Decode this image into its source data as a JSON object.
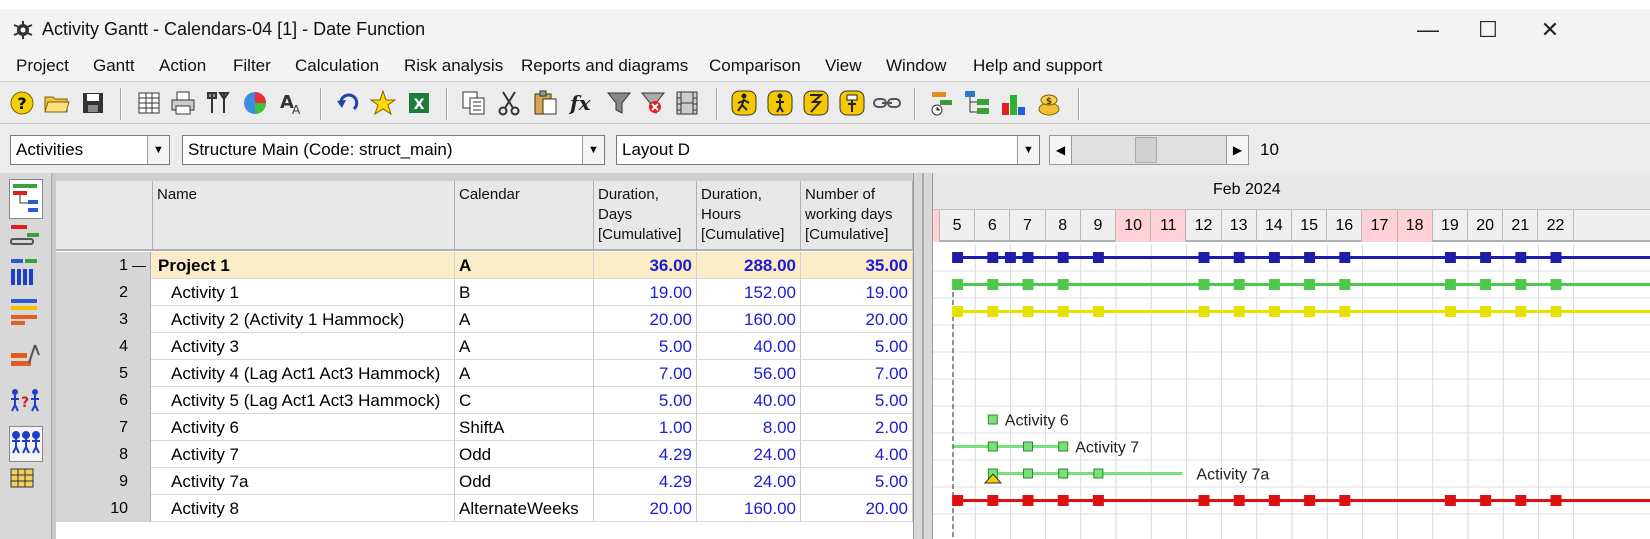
{
  "window": {
    "title": "Activity Gantt - Calendars-04 [1] - Date Function",
    "min_glyph": "—",
    "max_glyph": "☐",
    "close_glyph": "✕"
  },
  "menu": [
    "Project",
    "Gantt",
    "Action",
    "Filter",
    "Calculation",
    "Risk analysis",
    "Reports and diagrams",
    "Comparison",
    "View",
    "Window",
    "Help and support"
  ],
  "toolbar_icons": [
    "help-icon",
    "open-folder-icon",
    "save-icon",
    "table-icon",
    "printer-icon",
    "tools-icon",
    "pie-chart-icon",
    "font-icon",
    "undo-icon",
    "star-icon",
    "excel-icon",
    "copy-icon",
    "cut-icon",
    "paste-icon",
    "function-icon",
    "filter-icon",
    "clear-filter-icon",
    "film-icon",
    "walk-icon",
    "person-icon",
    "person-bolt-icon",
    "person-flag-icon",
    "link-icon",
    "schedule-icon",
    "tree-icon",
    "bar-chart-icon",
    "money-icon"
  ],
  "selectors": {
    "view": "Activities",
    "structure": "Structure Main (Code: struct_main)",
    "layout": "Layout D",
    "zoom_value": "10",
    "slider_fraction": 0.47
  },
  "columns": [
    "Name",
    "Calendar",
    "Duration,\nDays\n[Cumulative]",
    "Duration,\nHours\n[Cumulative]",
    "Number of\nworking days\n[Cumulative]"
  ],
  "rows": [
    {
      "num": "1",
      "collapse": "—",
      "name": "Project 1",
      "calendar": "A",
      "days": "36.00",
      "hours": "288.00",
      "workdays": "35.00",
      "summary": true
    },
    {
      "num": "2",
      "name": "Activity 1",
      "calendar": "B",
      "days": "19.00",
      "hours": "152.00",
      "workdays": "19.00"
    },
    {
      "num": "3",
      "name": "Activity 2 (Activity 1 Hammock)",
      "calendar": "A",
      "days": "20.00",
      "hours": "160.00",
      "workdays": "20.00"
    },
    {
      "num": "4",
      "name": "Activity 3",
      "calendar": "A",
      "days": "5.00",
      "hours": "40.00",
      "workdays": "5.00"
    },
    {
      "num": "5",
      "name": "Activity 4 (Lag Act1 Act3 Hammock)",
      "calendar": "A",
      "days": "7.00",
      "hours": "56.00",
      "workdays": "7.00"
    },
    {
      "num": "6",
      "name": "Activity 5 (Lag Act1 Act3 Hammock)",
      "calendar": "C",
      "days": "5.00",
      "hours": "40.00",
      "workdays": "5.00"
    },
    {
      "num": "7",
      "name": "Activity 6",
      "calendar": "ShiftA",
      "days": "1.00",
      "hours": "8.00",
      "workdays": "2.00"
    },
    {
      "num": "8",
      "name": "Activity 7",
      "calendar": "Odd",
      "days": "4.29",
      "hours": "24.00",
      "workdays": "4.00"
    },
    {
      "num": "9",
      "name": "Activity 7a",
      "calendar": "Odd",
      "days": "4.29",
      "hours": "24.00",
      "workdays": "5.00"
    },
    {
      "num": "10",
      "name": "Activity 8",
      "calendar": "AlternateWeeks",
      "days": "20.00",
      "hours": "160.00",
      "workdays": "20.00"
    }
  ],
  "gantt": {
    "month": "Feb 2024",
    "days": [
      "5",
      "6",
      "7",
      "8",
      "9",
      "10",
      "11",
      "12",
      "13",
      "14",
      "15",
      "16",
      "17",
      "18",
      "19",
      "20",
      "21",
      "22"
    ],
    "weekend_days": [
      "10",
      "11",
      "17",
      "18"
    ],
    "colors": {
      "weekend": "#ffd0d8",
      "project": "#1e1eaa",
      "activity1": "#4ec94e",
      "activity2": "#e8e000",
      "activity8": "#dd1111",
      "bar_light": "#7be07b"
    },
    "bars": [
      {
        "row": 1,
        "color": "project",
        "from_day": "5",
        "to_day": "22",
        "markers": [
          "5",
          "6",
          "6.5",
          "7",
          "8",
          "9",
          "12",
          "13",
          "14",
          "15",
          "16",
          "19",
          "20",
          "21",
          "22"
        ]
      },
      {
        "row": 2,
        "color": "activity1",
        "from_day": "5",
        "to_day": "22",
        "markers": [
          "5",
          "6",
          "7",
          "8",
          "12",
          "13",
          "14",
          "15",
          "16",
          "19",
          "20",
          "21",
          "22"
        ]
      },
      {
        "row": 3,
        "color": "activity2",
        "from_day": "5",
        "to_day": "22",
        "markers": [
          "5",
          "6",
          "7",
          "8",
          "9",
          "12",
          "13",
          "14",
          "15",
          "16",
          "19",
          "20",
          "21",
          "22"
        ]
      },
      {
        "row": 7,
        "color": "bar_light",
        "from_day": "6",
        "to_day": "6",
        "markers": [
          "6"
        ],
        "label": "Activity 6"
      },
      {
        "row": 8,
        "color": "bar_light",
        "from_day": "5",
        "to_day": "8",
        "markers": [
          "6",
          "7",
          "8"
        ],
        "label": "Activity 7"
      },
      {
        "row": 9,
        "color": "bar_light",
        "from_day": "6",
        "to_day": "12",
        "markers": [
          "6",
          "7",
          "8",
          "9"
        ],
        "label": "Activity 7a"
      },
      {
        "row": 10,
        "color": "activity8",
        "from_day": "5",
        "to_day": "22",
        "markers": [
          "5",
          "6",
          "7",
          "8",
          "9",
          "12",
          "13",
          "14",
          "15",
          "16",
          "19",
          "20",
          "21",
          "22"
        ]
      }
    ]
  },
  "left_strip_icons": [
    "gantt-view-icon",
    "network-icon",
    "resource-icon",
    "people-icon",
    "structure-icon",
    "bars-icon",
    "person-question-icon",
    "team-icon",
    "grid-icon"
  ]
}
